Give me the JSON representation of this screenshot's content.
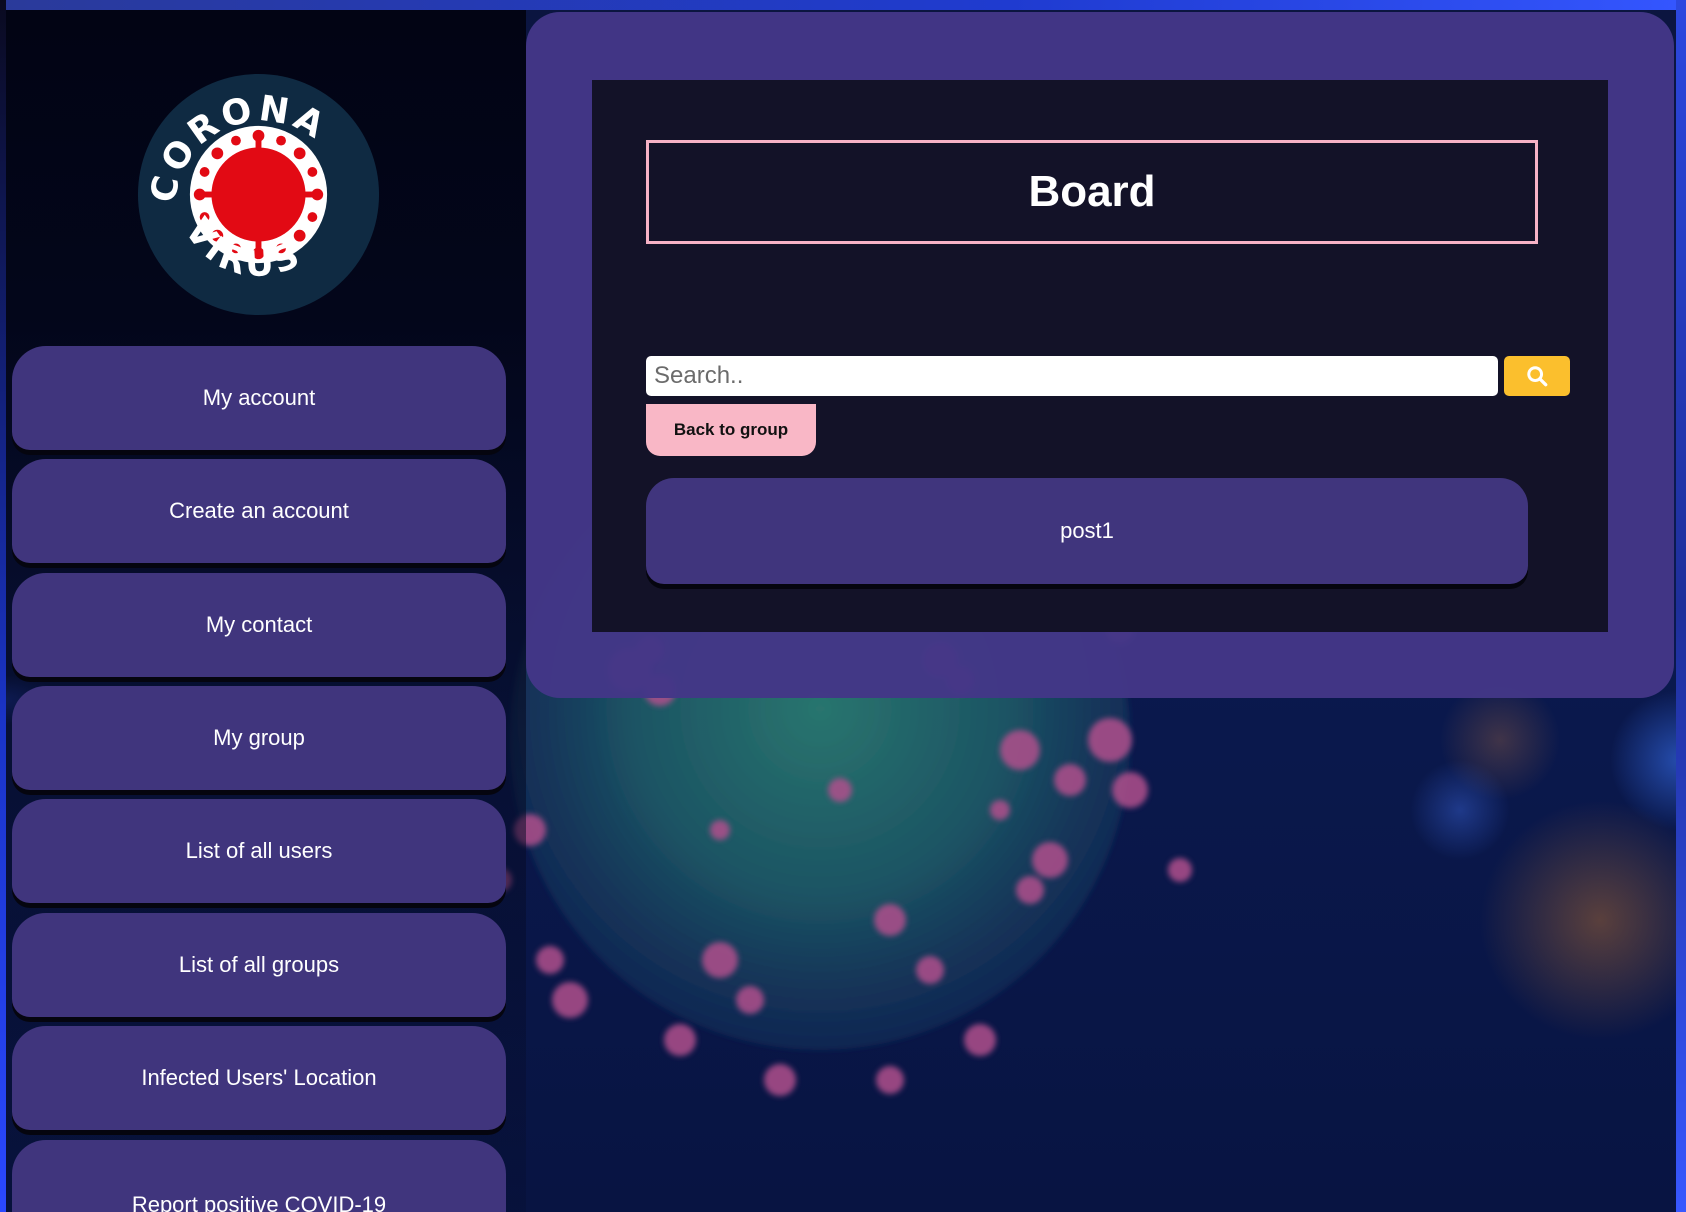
{
  "logo": {
    "top_text": "CORONA",
    "bottom_text": "VIRUS",
    "colors": {
      "ring": "#0f2a42",
      "inner": "#ffffff",
      "core": "#e20a14"
    }
  },
  "sidebar": {
    "items": [
      {
        "label": "My account"
      },
      {
        "label": "Create an account"
      },
      {
        "label": "My contact"
      },
      {
        "label": "My group"
      },
      {
        "label": "List of all users"
      },
      {
        "label": "List of all groups"
      },
      {
        "label": "Infected Users' Location"
      },
      {
        "label": "Report positive COVID-19"
      }
    ]
  },
  "board": {
    "title": "Board",
    "search": {
      "placeholder": "Search..",
      "value": "",
      "button_icon": "search-icon"
    },
    "back_button": "Back to group",
    "posts": [
      {
        "title": "post1"
      }
    ]
  },
  "colors": {
    "nav_bg": "#40357d",
    "panel_bg": "#433787",
    "board_bg": "#131228",
    "title_border": "#f6b2c6",
    "search_button": "#fbbf2d",
    "back_button": "#f9b7c6"
  }
}
